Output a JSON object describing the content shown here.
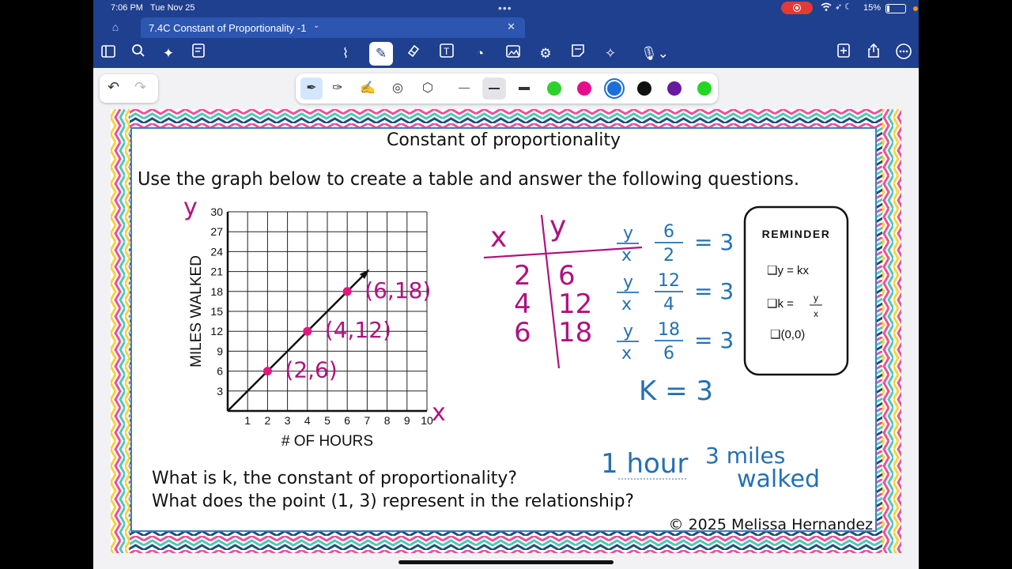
{
  "status_bar": {
    "time": "7:06 PM",
    "date": "Tue Nov 25",
    "battery": "15%"
  },
  "tab": {
    "title": "7.4C Constant of Proportionality -1"
  },
  "icons": {
    "home": "home-icon",
    "sidebar": "sidebar-icon",
    "search": "search-icon",
    "magic": "magic-icon",
    "pages": "pages-icon",
    "lasso": "lasso-icon",
    "pen": "pen-icon",
    "eraser": "eraser-icon",
    "text": "text-box-icon",
    "shapes": "shapes-icon",
    "image": "image-icon",
    "elements": "elements-icon",
    "sticky": "sticky-note-icon",
    "laser": "laser-pointer-icon",
    "mic": "microphone-icon",
    "add_page": "add-page-icon",
    "share": "share-icon",
    "more": "more-icon"
  },
  "pen_colors": [
    "#2dd12d",
    "#e60c8c",
    "#1c6fd8",
    "#111111",
    "#6a1aa0",
    "#23d623"
  ],
  "worksheet": {
    "title": "Constant of proportionality",
    "instructions": "Use the graph below to create a table and answer the following questions.",
    "question1": "What is k, the constant of proportionality?",
    "question2": "What does the point (1, 3) represent in the relationship?",
    "copyright": "© 2025 Melissa Hernandez",
    "reminder": {
      "title": "REMINDER",
      "item1": "❑y = kx",
      "item2_prefix": "❑k =",
      "item2_num": "y",
      "item2_den": "x",
      "item3": "❑(0,0)"
    }
  },
  "chart_data": {
    "type": "line",
    "xlabel": "# OF HOURS",
    "ylabel": "MILES WALKED",
    "x_ticks": [
      "1",
      "2",
      "3",
      "4",
      "5",
      "6",
      "7",
      "8",
      "9",
      "10"
    ],
    "y_ticks": [
      "3",
      "6",
      "9",
      "12",
      "15",
      "18",
      "21",
      "24",
      "27",
      "30"
    ],
    "xlim": [
      0,
      10
    ],
    "ylim": [
      0,
      30
    ],
    "grid": true,
    "line": {
      "x": [
        0,
        7
      ],
      "y": [
        0,
        21
      ]
    },
    "points": [
      {
        "x": 2,
        "y": 6
      },
      {
        "x": 4,
        "y": 12
      },
      {
        "x": 6,
        "y": 18
      }
    ]
  },
  "annotations": {
    "axis_x": "x",
    "axis_y": "y",
    "point_labels": [
      "(2,6)",
      "(4,12)",
      "(6,18)"
    ],
    "table": {
      "header_x": "x",
      "header_y": "y",
      "rows": [
        [
          "2",
          "6"
        ],
        [
          "4",
          "12"
        ],
        [
          "6",
          "18"
        ]
      ]
    },
    "ratios": [
      {
        "num": "6",
        "den": "2",
        "result": "= 3"
      },
      {
        "num": "12",
        "den": "4",
        "result": "= 3"
      },
      {
        "num": "18",
        "den": "6",
        "result": "= 3"
      }
    ],
    "ratio_num": "y",
    "ratio_den": "x",
    "k_result": "K = 3",
    "answer_hour": "1 hour",
    "answer_miles": "3 miles",
    "answer_walked": "walked"
  }
}
